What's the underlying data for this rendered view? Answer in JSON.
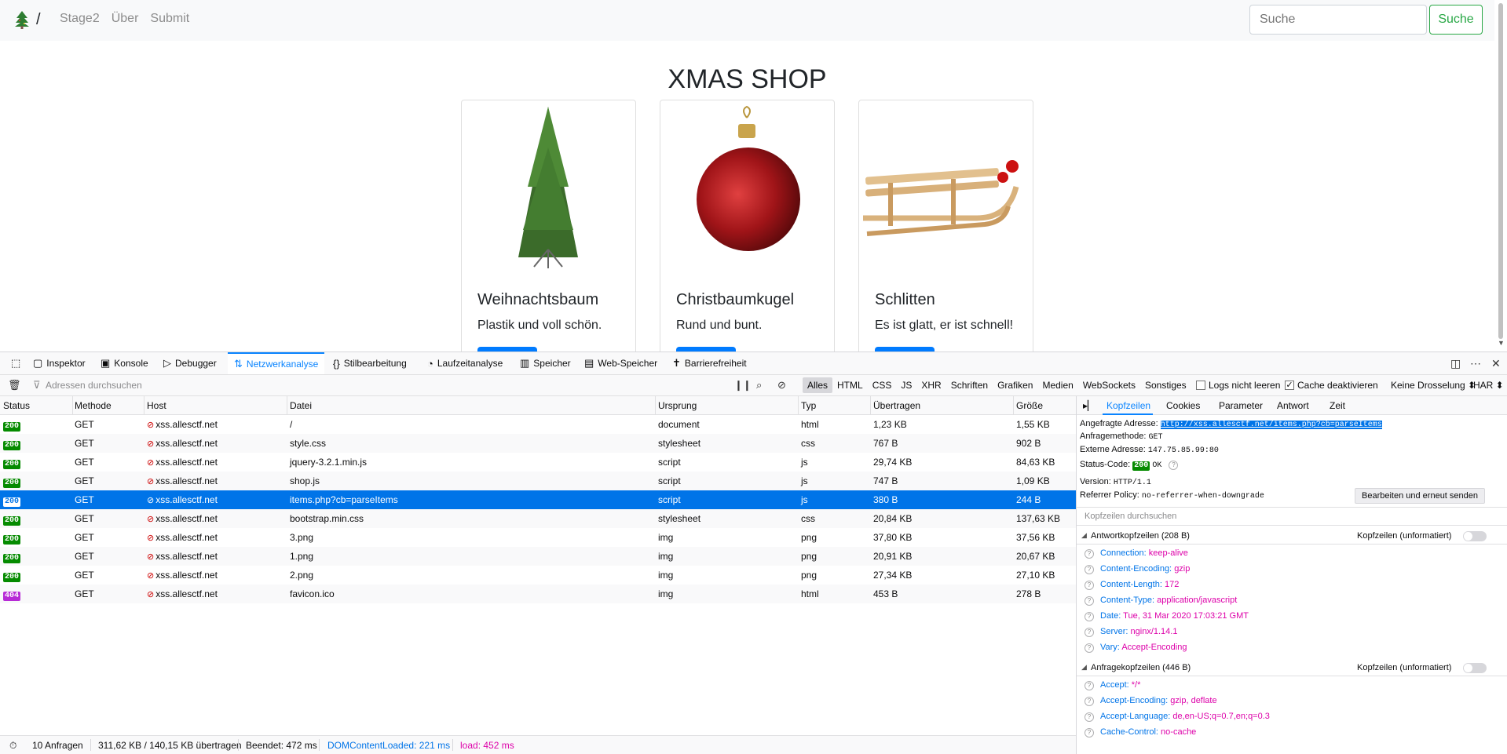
{
  "site": {
    "brand_slash": "/",
    "nav": [
      "Stage2",
      "Über",
      "Submit"
    ],
    "search_placeholder": "Suche",
    "search_button": "Suche",
    "title": "XMAS SHOP",
    "products": [
      {
        "name": "Weihnachtsbaum",
        "desc": "Plastik und voll schön.",
        "image": "christmas-tree"
      },
      {
        "name": "Christbaumkugel",
        "desc": "Rund und bunt.",
        "image": "red-bauble"
      },
      {
        "name": "Schlitten",
        "desc": "Es ist glatt, er ist schnell!",
        "image": "wooden-sled"
      }
    ]
  },
  "devtools": {
    "tabs": [
      "Inspektor",
      "Konsole",
      "Debugger",
      "Netzwerkanalyse",
      "Stilbearbeitung",
      "Laufzeitanalyse",
      "Speicher",
      "Web-Speicher",
      "Barrierefreiheit"
    ],
    "active_tab": "Netzwerkanalyse",
    "filter_placeholder": "Adressen durchsuchen",
    "type_filters": [
      "Alles",
      "HTML",
      "CSS",
      "JS",
      "XHR",
      "Schriften",
      "Grafiken",
      "Medien",
      "WebSockets",
      "Sonstiges"
    ],
    "active_filter": "Alles",
    "persist_logs": "Logs nicht leeren",
    "disable_cache": "Cache deaktivieren",
    "throttling": "Keine Drosselung ⬍",
    "har": "HAR ⬍",
    "columns": [
      "Status",
      "Methode",
      "Host",
      "Datei",
      "Ursprung",
      "Typ",
      "Übertragen",
      "Größe"
    ],
    "requests": [
      {
        "status": "200",
        "method": "GET",
        "host": "xss.allesctf.net",
        "file": "/",
        "cause": "document",
        "type": "html",
        "transferred": "1,23 KB",
        "size": "1,55 KB"
      },
      {
        "status": "200",
        "method": "GET",
        "host": "xss.allesctf.net",
        "file": "style.css",
        "cause": "stylesheet",
        "type": "css",
        "transferred": "767 B",
        "size": "902 B"
      },
      {
        "status": "200",
        "method": "GET",
        "host": "xss.allesctf.net",
        "file": "jquery-3.2.1.min.js",
        "cause": "script",
        "type": "js",
        "transferred": "29,74 KB",
        "size": "84,63 KB"
      },
      {
        "status": "200",
        "method": "GET",
        "host": "xss.allesctf.net",
        "file": "shop.js",
        "cause": "script",
        "type": "js",
        "transferred": "747 B",
        "size": "1,09 KB"
      },
      {
        "status": "200",
        "method": "GET",
        "host": "xss.allesctf.net",
        "file": "items.php?cb=parseItems",
        "cause": "script",
        "type": "js",
        "transferred": "380 B",
        "size": "244 B"
      },
      {
        "status": "200",
        "method": "GET",
        "host": "xss.allesctf.net",
        "file": "bootstrap.min.css",
        "cause": "stylesheet",
        "type": "css",
        "transferred": "20,84 KB",
        "size": "137,63 KB"
      },
      {
        "status": "200",
        "method": "GET",
        "host": "xss.allesctf.net",
        "file": "3.png",
        "cause": "img",
        "type": "png",
        "transferred": "37,80 KB",
        "size": "37,56 KB"
      },
      {
        "status": "200",
        "method": "GET",
        "host": "xss.allesctf.net",
        "file": "1.png",
        "cause": "img",
        "type": "png",
        "transferred": "20,91 KB",
        "size": "20,67 KB"
      },
      {
        "status": "200",
        "method": "GET",
        "host": "xss.allesctf.net",
        "file": "2.png",
        "cause": "img",
        "type": "png",
        "transferred": "27,34 KB",
        "size": "27,10 KB"
      },
      {
        "status": "404",
        "method": "GET",
        "host": "xss.allesctf.net",
        "file": "favicon.ico",
        "cause": "img",
        "type": "html",
        "transferred": "453 B",
        "size": "278 B"
      }
    ],
    "selected_request": "items.php?cb=parseItems",
    "statusbar": {
      "requests": "10 Anfragen",
      "transferred": "311,62 KB / 140,15 KB übertragen",
      "finished": "Beendet: 472 ms",
      "dcl": "DOMContentLoaded: 221 ms",
      "load": "load: 452 ms"
    },
    "details": {
      "tabs": [
        "Kopfzeilen",
        "Cookies",
        "Parameter",
        "Antwort",
        "Zeit"
      ],
      "active_tab": "Kopfzeilen",
      "url_label": "Angefragte Adresse:",
      "url": "http://xss.allesctf.net/items.php?cb=parseItems",
      "method_label": "Anfragemethode:",
      "method": "GET",
      "remote_label": "Externe Adresse:",
      "remote": "147.75.85.99:80",
      "status_label": "Status-Code:",
      "status_code": "200",
      "status_text": "OK",
      "version_label": "Version:",
      "version": "HTTP/1.1",
      "referrer_label": "Referrer Policy:",
      "referrer": "no-referrer-when-downgrade",
      "resend": "Bearbeiten und erneut senden",
      "header_filter": "Kopfzeilen durchsuchen",
      "raw_label": "Kopfzeilen (unformatiert)",
      "response_title": "Antwortkopfzeilen (208 B)",
      "response_headers": [
        {
          "k": "Connection:",
          "v": "keep-alive"
        },
        {
          "k": "Content-Encoding:",
          "v": "gzip"
        },
        {
          "k": "Content-Length:",
          "v": "172"
        },
        {
          "k": "Content-Type:",
          "v": "application/javascript"
        },
        {
          "k": "Date:",
          "v": "Tue, 31 Mar 2020 17:03:21 GMT"
        },
        {
          "k": "Server:",
          "v": "nginx/1.14.1"
        },
        {
          "k": "Vary:",
          "v": "Accept-Encoding"
        }
      ],
      "request_title": "Anfragekopfzeilen (446 B)",
      "request_headers": [
        {
          "k": "Accept:",
          "v": "*/*"
        },
        {
          "k": "Accept-Encoding:",
          "v": "gzip, deflate"
        },
        {
          "k": "Accept-Language:",
          "v": "de,en-US;q=0.7,en;q=0.3"
        },
        {
          "k": "Cache-Control:",
          "v": "no-cache"
        }
      ]
    }
  }
}
